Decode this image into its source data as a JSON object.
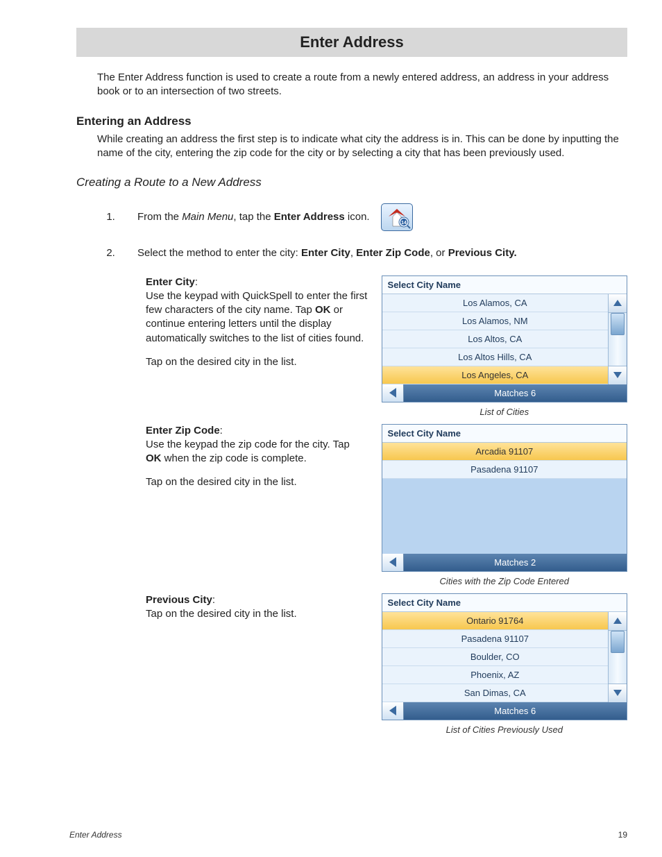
{
  "title": "Enter Address",
  "intro": "The Enter Address function is used to create a route from a newly entered address, an address in your address book or to an intersection of two streets.",
  "section1": {
    "heading": "Entering an Address",
    "text": "While creating an address the first step is to indicate what city the address is in.  This can be done by inputting the name of the city, entering the zip code for the city or by selecting a city that has been previously used."
  },
  "section2": {
    "heading": "Creating a Route to a New Address",
    "step1_a": "From the ",
    "step1_b": "Main Menu",
    "step1_c": ", tap the ",
    "step1_d": "Enter Address",
    "step1_e": " icon.",
    "step2_a": "Select the method to enter the city: ",
    "step2_b": "Enter City",
    "step2_c": ", ",
    "step2_d": "Enter Zip Code",
    "step2_e": ", or ",
    "step2_f": "Previous City."
  },
  "blocks": {
    "enterCity": {
      "label": "Enter City",
      "p1a": "Use the keypad with QuickSpell to enter the first few characters of the city name.  Tap ",
      "p1b": "OK",
      "p1c": " or continue entering letters until the display automatically switches to the list of cities found.",
      "p2": "Tap on the desired city in the list."
    },
    "enterZip": {
      "label": "Enter Zip Code",
      "p1a": "Use the keypad the zip code for the city.  Tap ",
      "p1b": "OK",
      "p1c": " when the zip code is complete.",
      "p2": "Tap on the desired city in the list."
    },
    "prevCity": {
      "label": "Previous City",
      "p1": "Tap on the desired city in the list."
    }
  },
  "widgets": {
    "header": "Select City Name",
    "cities": {
      "rows": [
        "Los Alamos, CA",
        "Los Alamos, NM",
        "Los Altos, CA",
        "Los Altos Hills, CA",
        "Los Angeles, CA"
      ],
      "selected": 4,
      "footer": "Matches  6",
      "caption": "List of Cities"
    },
    "zip": {
      "rows": [
        "Arcadia 91107",
        "Pasadena 91107"
      ],
      "selected": 0,
      "footer": "Matches  2",
      "caption": "Cities with the Zip Code Entered"
    },
    "prev": {
      "rows": [
        "Ontario 91764",
        "Pasadena 91107",
        "Boulder, CO",
        "Phoenix, AZ",
        "San Dimas, CA"
      ],
      "selected": 0,
      "footer": "Matches  6",
      "caption": "List of Cities Previously Used"
    }
  },
  "icon_badge": "14",
  "footer": {
    "left": "Enter Address",
    "right": "19"
  }
}
